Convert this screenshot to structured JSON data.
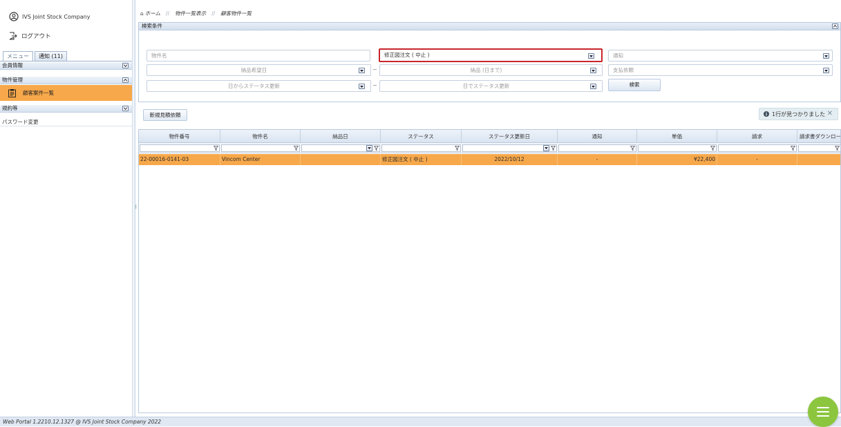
{
  "sidebar": {
    "company": "IVS Joint Stock Company",
    "logout": "ログアウト",
    "tabs": [
      {
        "label": "メニュー"
      },
      {
        "label": "通知 (11)"
      }
    ],
    "groups": [
      {
        "label": "会員情報"
      },
      {
        "label": "物件管理"
      }
    ],
    "active_item": "顧客案件一覧",
    "groups2": [
      {
        "label": "規約等"
      },
      {
        "label": "パスワード変更"
      }
    ]
  },
  "breadcrumb": [
    "ホーム",
    "物件一覧表示",
    "顧客物件一覧"
  ],
  "search_panel": {
    "title": "検索条件",
    "fields": {
      "property_name": "物件名",
      "status": "修正図注文 ( 中止 )",
      "notification": "通知",
      "desired_delivery_date": "納品希望日",
      "delivery_until": "納品 (日まで)",
      "payment_request": "支払依頼",
      "status_updated_from": "日からステータス更新",
      "status_updated_to": "日でステータス更新"
    },
    "tilde": "~",
    "search_button": "検索"
  },
  "new_quote_button": "新規見積依頼",
  "notice": "1行が見つかりました",
  "grid": {
    "columns": [
      {
        "label": "物件番号"
      },
      {
        "label": "物件名"
      },
      {
        "label": "納品日"
      },
      {
        "label": "ステータス"
      },
      {
        "label": "ステータス更新日"
      },
      {
        "label": "通知"
      },
      {
        "label": "単価"
      },
      {
        "label": "請求"
      },
      {
        "label": "請求書ダウンロード"
      }
    ],
    "rows": [
      {
        "property_no": "22-00016-0141-03",
        "property_name": "Vincom Center",
        "delivery_date": "",
        "status": "修正図注文 ( 中止 )",
        "status_updated": "2022/10/12",
        "notification": "-",
        "unit_price": "¥22,400",
        "billing": "-",
        "invoice_download": ""
      }
    ]
  },
  "footer": "Web Portal 1.2210.12.1327 @ IVS Joint Stock Company 2022",
  "colors": {
    "accent_orange": "#f7a84a",
    "highlight_red": "#c8252b",
    "fab_green": "#8cc63e"
  }
}
